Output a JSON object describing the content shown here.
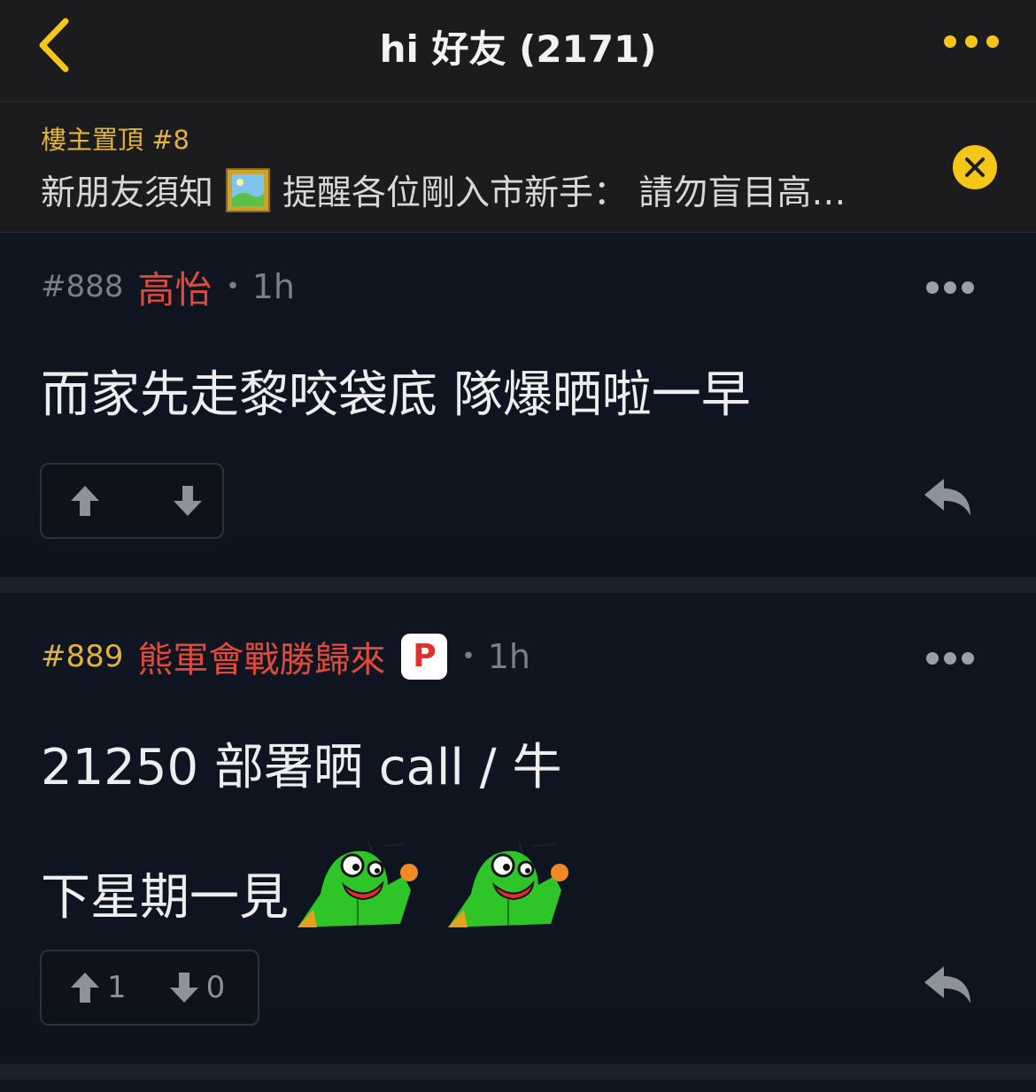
{
  "header": {
    "title": "hi 好友 (2171)",
    "accent_color": "#f5c518"
  },
  "pinned": {
    "label": "樓主置頂 #8",
    "text_before": "新朋友須知",
    "text_after": "提醒各位剛入市新手： 請勿盲目高…",
    "image_icon": "framed-picture-icon"
  },
  "posts": [
    {
      "floor": "#888",
      "author": "高怡",
      "dot": "•",
      "time": "1h",
      "content": "而家先走黎咬袋底 隊爆晒啦一早",
      "upvotes": "",
      "downvotes": ""
    },
    {
      "floor": "#889",
      "author": "熊軍會戰勝歸來",
      "badge": "P",
      "dot": "•",
      "time": "1h",
      "content_line1": "21250 部署晒 call / 牛",
      "content_line2": "下星期一見",
      "upvotes": "1",
      "downvotes": "0"
    }
  ]
}
